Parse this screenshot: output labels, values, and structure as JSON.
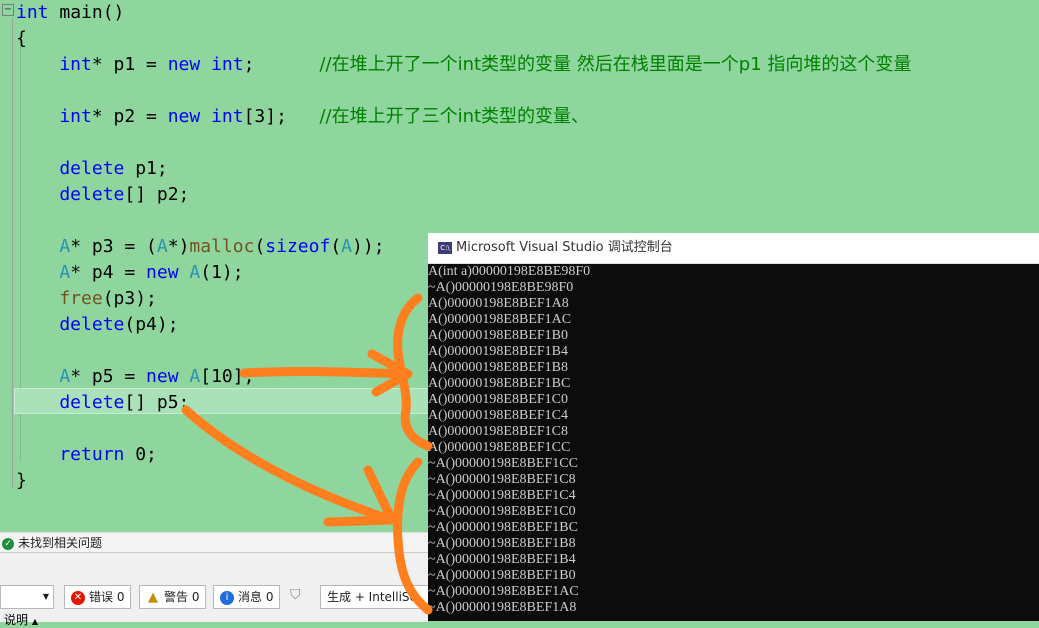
{
  "editor": {
    "fold_glyph": "−",
    "lines": [
      {
        "parts": [
          {
            "t": "int",
            "c": "kw"
          },
          {
            "t": " main()",
            "c": ""
          }
        ]
      },
      {
        "parts": [
          {
            "t": "{",
            "c": ""
          }
        ]
      },
      {
        "parts": [
          {
            "t": "    int",
            "c": "kw"
          },
          {
            "t": "* p1 = ",
            "c": ""
          },
          {
            "t": "new",
            "c": "kw"
          },
          {
            "t": " ",
            "c": ""
          },
          {
            "t": "int",
            "c": "kw"
          },
          {
            "t": ";      ",
            "c": ""
          },
          {
            "t": "//在堆上开了一个int类型的变量 然后在栈里面是一个p1 指向堆的这个变量",
            "c": "cm"
          }
        ]
      },
      {
        "parts": [
          {
            "t": "",
            "c": ""
          }
        ]
      },
      {
        "parts": [
          {
            "t": "    int",
            "c": "kw"
          },
          {
            "t": "* p2 = ",
            "c": ""
          },
          {
            "t": "new",
            "c": "kw"
          },
          {
            "t": " ",
            "c": ""
          },
          {
            "t": "int",
            "c": "kw"
          },
          {
            "t": "[3];   ",
            "c": ""
          },
          {
            "t": "//在堆上开了三个int类型的变量、",
            "c": "cm"
          }
        ]
      },
      {
        "parts": [
          {
            "t": "",
            "c": ""
          }
        ]
      },
      {
        "parts": [
          {
            "t": "    delete",
            "c": "kw"
          },
          {
            "t": " p1;",
            "c": ""
          }
        ]
      },
      {
        "parts": [
          {
            "t": "    delete",
            "c": "kw"
          },
          {
            "t": "[] p2;",
            "c": ""
          }
        ]
      },
      {
        "parts": [
          {
            "t": "",
            "c": ""
          }
        ]
      },
      {
        "parts": [
          {
            "t": "    A",
            "c": "ty"
          },
          {
            "t": "* p3 = (",
            "c": ""
          },
          {
            "t": "A",
            "c": "ty"
          },
          {
            "t": "*)",
            "c": ""
          },
          {
            "t": "malloc",
            "c": "fn"
          },
          {
            "t": "(",
            "c": ""
          },
          {
            "t": "sizeof",
            "c": "kw"
          },
          {
            "t": "(",
            "c": ""
          },
          {
            "t": "A",
            "c": "ty"
          },
          {
            "t": "));",
            "c": ""
          }
        ]
      },
      {
        "parts": [
          {
            "t": "    A",
            "c": "ty"
          },
          {
            "t": "* p4 = ",
            "c": ""
          },
          {
            "t": "new",
            "c": "kw"
          },
          {
            "t": " ",
            "c": ""
          },
          {
            "t": "A",
            "c": "ty"
          },
          {
            "t": "(1);",
            "c": ""
          }
        ]
      },
      {
        "parts": [
          {
            "t": "    free",
            "c": "fn"
          },
          {
            "t": "(p3);",
            "c": ""
          }
        ]
      },
      {
        "parts": [
          {
            "t": "    delete",
            "c": "kw"
          },
          {
            "t": "(p4);",
            "c": ""
          }
        ]
      },
      {
        "parts": [
          {
            "t": "",
            "c": ""
          }
        ]
      },
      {
        "parts": [
          {
            "t": "    A",
            "c": "ty"
          },
          {
            "t": "* p5 = ",
            "c": ""
          },
          {
            "t": "new",
            "c": "kw"
          },
          {
            "t": " ",
            "c": ""
          },
          {
            "t": "A",
            "c": "ty"
          },
          {
            "t": "[10];",
            "c": ""
          }
        ]
      },
      {
        "parts": [
          {
            "t": "    delete",
            "c": "kw"
          },
          {
            "t": "[] p5;",
            "c": ""
          }
        ]
      },
      {
        "parts": [
          {
            "t": "",
            "c": ""
          }
        ]
      },
      {
        "parts": [
          {
            "t": "    return",
            "c": "kw"
          },
          {
            "t": " 0;",
            "c": ""
          }
        ]
      },
      {
        "parts": [
          {
            "t": "}",
            "c": ""
          }
        ]
      }
    ]
  },
  "status": {
    "no_issues": "未找到相关问题"
  },
  "error_list": {
    "errors_label": "错误 0",
    "warnings_label": "警告 0",
    "messages_label": "消息 0",
    "build_filter": "生成 + IntelliSe",
    "column_label": "说明"
  },
  "console": {
    "title": "Microsoft Visual Studio 调试控制台",
    "icon_text": "C:\\",
    "lines": [
      "A(int a)00000198E8BE98F0",
      "~A()00000198E8BE98F0",
      "A()00000198E8BEF1A8",
      "A()00000198E8BEF1AC",
      "A()00000198E8BEF1B0",
      "A()00000198E8BEF1B4",
      "A()00000198E8BEF1B8",
      "A()00000198E8BEF1BC",
      "A()00000198E8BEF1C0",
      "A()00000198E8BEF1C4",
      "A()00000198E8BEF1C8",
      "A()00000198E8BEF1CC",
      "~A()00000198E8BEF1CC",
      "~A()00000198E8BEF1C8",
      "~A()00000198E8BEF1C4",
      "~A()00000198E8BEF1C0",
      "~A()00000198E8BEF1BC",
      "~A()00000198E8BEF1B8",
      "~A()00000198E8BEF1B4",
      "~A()00000198E8BEF1B0",
      "~A()00000198E8BEF1AC",
      "~A()00000198E8BEF1A8"
    ]
  },
  "colors": {
    "editor_bg": "#8ed69d",
    "annotation": "#ff7f1f",
    "console_bg": "#0c0c0c"
  }
}
